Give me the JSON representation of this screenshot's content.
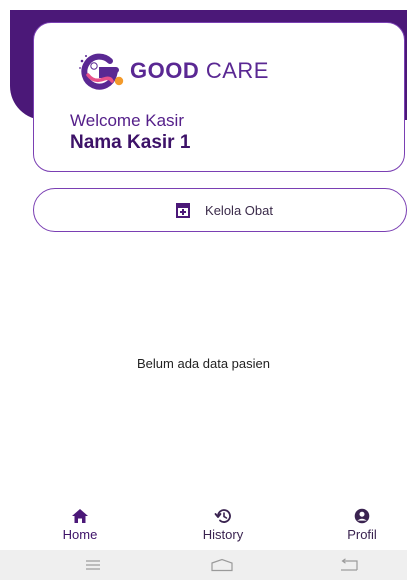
{
  "header": {
    "brand_bold": "GOOD",
    "brand_light": " CARE",
    "welcome_label": "Welcome Kasir",
    "cashier_name": "Nama Kasir 1"
  },
  "actions": {
    "kelola_obat_label": "Kelola Obat",
    "kelola_obat_icon": "medicine-box-icon"
  },
  "main": {
    "empty_message": "Belum ada data pasien"
  },
  "bottom_nav": {
    "items": [
      {
        "label": "Home",
        "icon": "home-icon",
        "active": true
      },
      {
        "label": "History",
        "icon": "history-icon",
        "active": false
      },
      {
        "label": "Profil",
        "icon": "user-circle-icon",
        "active": false
      }
    ]
  },
  "system_nav": {
    "buttons": [
      "menu-icon",
      "home-outline-icon",
      "back-icon"
    ]
  },
  "colors": {
    "primary": "#4b1878",
    "accent": "#7a3fb3",
    "text_dark": "#3d1268",
    "logo_pink": "#e8508a",
    "logo_orange": "#f39a2b"
  }
}
